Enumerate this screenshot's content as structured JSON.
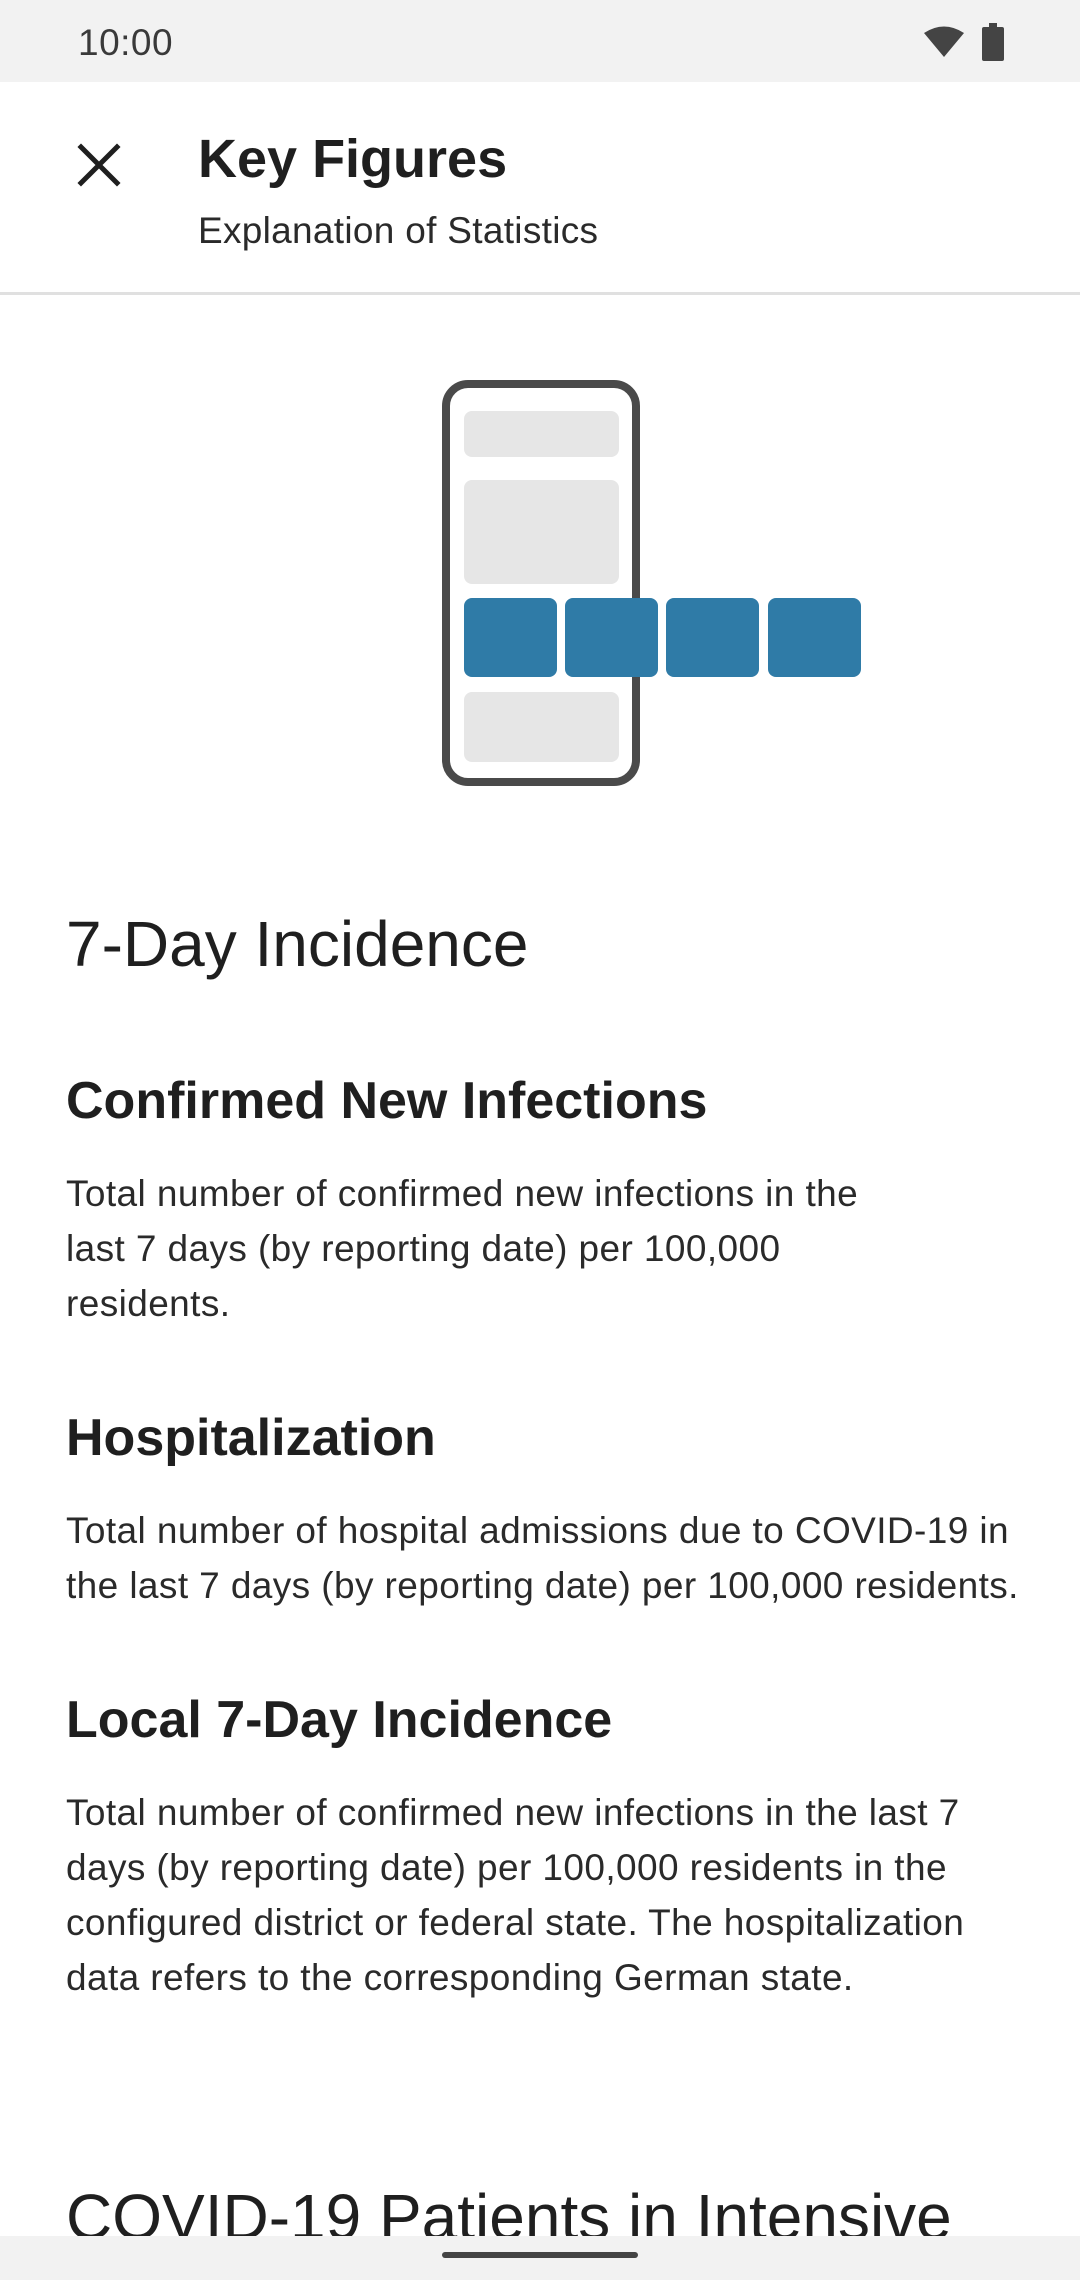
{
  "status_bar": {
    "time": "10:00",
    "icons": [
      "wifi-icon",
      "battery-icon"
    ]
  },
  "toolbar": {
    "close_icon": "close-icon",
    "title": "Key Figures",
    "subtitle": "Explanation of Statistics"
  },
  "illustration": {
    "icon": "phone-key-figures-illustration",
    "accent_color": "#2f7ba7",
    "placeholder_color": "#e6e6e6",
    "frame_color": "#4a4a4a"
  },
  "content": {
    "section_title": "7-Day Incidence",
    "items": [
      {
        "heading": "Confirmed New Infections",
        "body": "Total number of confirmed new infections in the last 7 days (by reporting date) per 100,000 residents."
      },
      {
        "heading": "Hospitalization",
        "body": "Total number of hospital admissions due to COVID-19 in the last 7 days (by reporting date) per 100,000 residents."
      },
      {
        "heading": "Local 7-Day Incidence",
        "body": "Total number of confirmed new infections in the last 7 days (by reporting date) per 100,000 residents in the configured district or federal state. The hospitalization data refers to the corresponding German state."
      }
    ],
    "next_section_title": "COVID-19 Patients in Intensive"
  }
}
